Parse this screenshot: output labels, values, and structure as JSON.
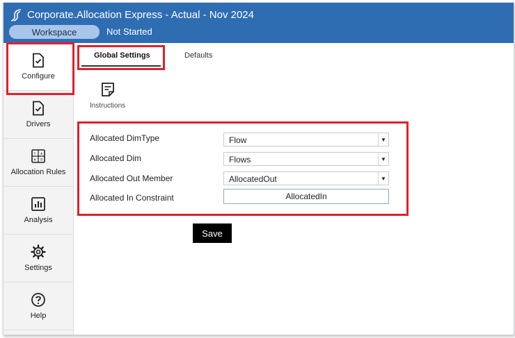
{
  "header": {
    "title": "Corporate.Allocation Express  -  Actual  -  Nov 2024",
    "workspace_label": "Workspace",
    "status": "Not Started"
  },
  "sidebar": {
    "items": [
      {
        "label": "Configure",
        "icon": "document-check-icon",
        "active": true
      },
      {
        "label": "Drivers",
        "icon": "document-check-icon"
      },
      {
        "label": "Allocation Rules",
        "icon": "calculator-icon"
      },
      {
        "label": "Analysis",
        "icon": "bar-chart-icon"
      },
      {
        "label": "Settings",
        "icon": "gear-icon"
      },
      {
        "label": "Help",
        "icon": "help-icon"
      }
    ]
  },
  "tabs": [
    {
      "label": "Global Settings",
      "active": true
    },
    {
      "label": "Defaults"
    }
  ],
  "instructions": {
    "label": "Instructions",
    "icon": "note-icon"
  },
  "form": {
    "fields": [
      {
        "label": "Allocated DimType",
        "value": "Flow"
      },
      {
        "label": "Allocated Dim",
        "value": "Flows"
      },
      {
        "label": "Allocated Out Member",
        "value": "AllocatedOut"
      },
      {
        "label": "Allocated In Constraint",
        "value": "AllocatedIn"
      }
    ]
  },
  "save_label": "Save",
  "colors": {
    "header": "#2f6db3",
    "highlight": "#e0202a",
    "save_button": "#000000"
  }
}
